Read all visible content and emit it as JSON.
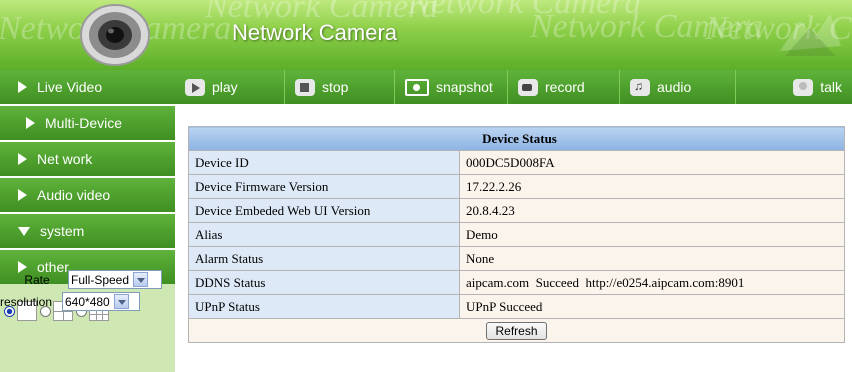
{
  "header": {
    "title": "Network Camera",
    "watermark": "Network Camera",
    "background": "#8fd04a"
  },
  "sidebar": {
    "items": [
      {
        "label": "Live Video",
        "arrow": "right"
      },
      {
        "label": "Multi-Device",
        "arrow": "right"
      },
      {
        "label": "Net work",
        "arrow": "right"
      },
      {
        "label": "Audio video",
        "arrow": "right"
      },
      {
        "label": "system",
        "arrow": "down"
      },
      {
        "label": "other",
        "arrow": "right"
      }
    ],
    "layout_options": [
      {
        "type": "single",
        "selected": true
      },
      {
        "type": "quad",
        "selected": false
      },
      {
        "type": "nine",
        "selected": false
      }
    ],
    "rate_label": "Rate",
    "rate_value": "Full-Speed",
    "resolution_label": "resolution",
    "resolution_value": "640*480"
  },
  "toolbar": {
    "buttons": [
      {
        "label": "play",
        "icon": "play-icon"
      },
      {
        "label": "stop",
        "icon": "stop-icon"
      },
      {
        "label": "snapshot",
        "icon": "camera-icon"
      },
      {
        "label": "record",
        "icon": "record-icon"
      },
      {
        "label": "audio",
        "icon": "audio-icon"
      },
      {
        "label": "talk",
        "icon": "talk-icon"
      }
    ],
    "background": "#4fa02e"
  },
  "status": {
    "title": "Device Status",
    "rows": [
      {
        "label": "Device ID",
        "value": "000DC5D008FA"
      },
      {
        "label": "Device Firmware Version",
        "value": "17.22.2.26"
      },
      {
        "label": "Device Embeded Web UI Version",
        "value": "20.8.4.23"
      },
      {
        "label": "Alias",
        "value": "Demo"
      },
      {
        "label": "Alarm Status",
        "value": "None"
      },
      {
        "label": "DDNS Status",
        "value": "aipcam.com  Succeed  http://e0254.aipcam.com:8901"
      },
      {
        "label": "UPnP Status",
        "value": "UPnP Succeed"
      }
    ],
    "refresh_label": "Refresh"
  }
}
